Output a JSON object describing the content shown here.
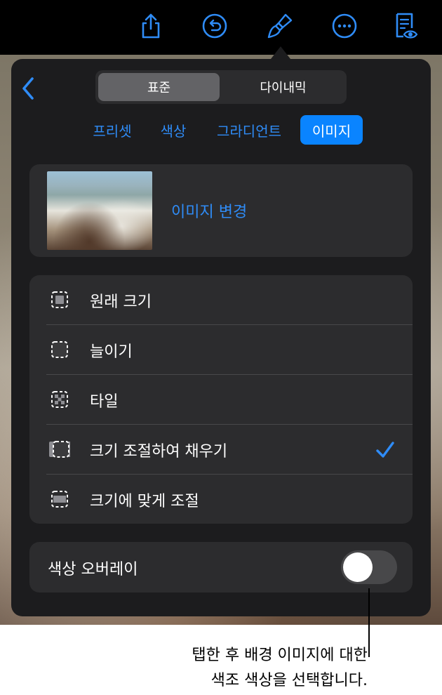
{
  "toolbar": {
    "icons": [
      "share-icon",
      "undo-icon",
      "format-brush-icon",
      "more-icon",
      "reader-view-icon"
    ]
  },
  "segmented": {
    "standard": "표준",
    "dynamic": "다이내믹"
  },
  "tabs": {
    "preset": "프리셋",
    "color": "색상",
    "gradient": "그라디언트",
    "image": "이미지"
  },
  "image_card": {
    "change_image": "이미지 변경"
  },
  "options": {
    "original_size": "원래 크기",
    "stretch": "늘이기",
    "tile": "타일",
    "scale_to_fill": "크기 조절하여 채우기",
    "scale_to_fit": "크기에 맞게 조절",
    "selected": "scale_to_fill"
  },
  "color_overlay": {
    "label": "색상 오버레이",
    "enabled": false
  },
  "callout": {
    "line1": "탭한 후 배경 이미지에 대한",
    "line2": "색조 색상을 선택합니다."
  },
  "colors": {
    "accent": "#0a84ff",
    "panel": "#1c1c1e",
    "card": "#2c2c2e"
  }
}
